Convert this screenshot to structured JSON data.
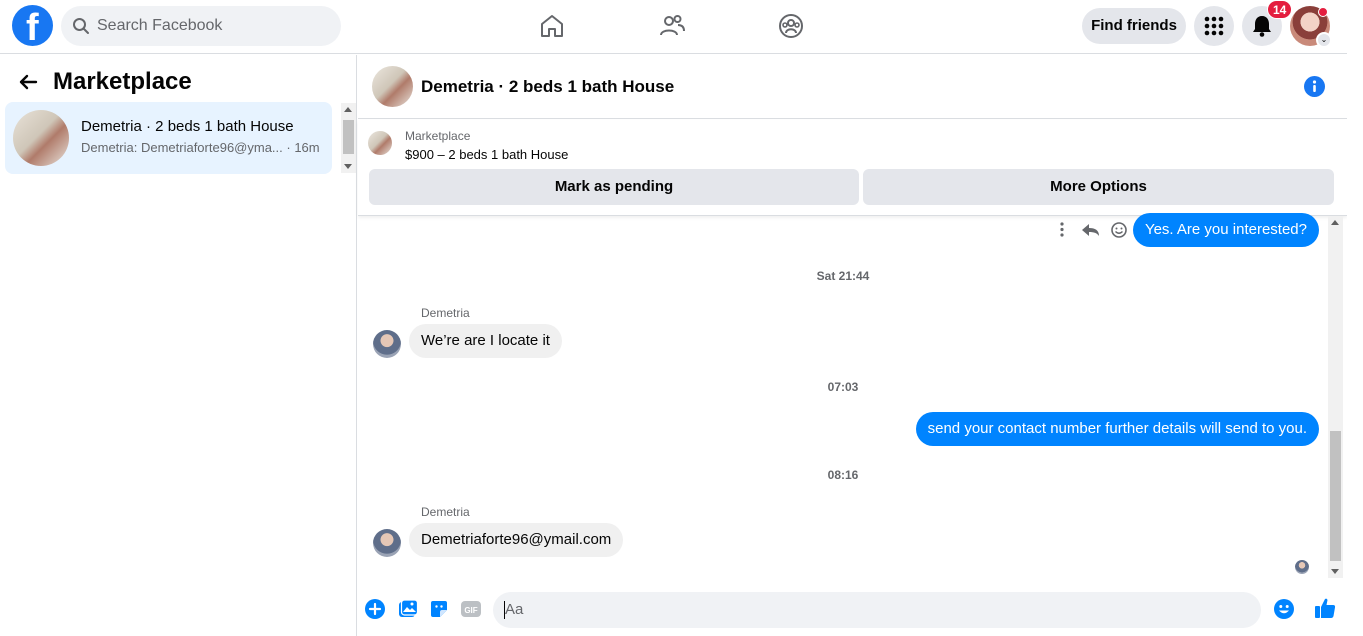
{
  "topbar": {
    "logo_letter": "f",
    "search_placeholder": "Search Facebook",
    "nav_icons": [
      "home-icon",
      "friends-icon",
      "groups-icon"
    ],
    "find_friends_label": "Find friends",
    "notification_count": "14"
  },
  "left": {
    "title": "Marketplace",
    "conversations": [
      {
        "name": "Demetria · 2 beds 1 bath House",
        "preview": "Demetria: Demetriaforte96@yma... · 16m"
      }
    ]
  },
  "chat": {
    "title": "Demetria · 2 beds 1 bath House",
    "listing_kind": "Marketplace",
    "listing_price": "$900 – 2 beds 1 bath House",
    "mark_pending_label": "Mark as pending",
    "more_options_label": "More Options",
    "messages": {
      "out1": "Yes. Are you interested?",
      "ts1": "Sat 21:44",
      "sender1": "Demetria",
      "in1": "We’re are I locate it",
      "ts2": "07:03",
      "out2": "send your contact number further details will send to you.",
      "ts3": "08:16",
      "sender2": "Demetria",
      "in2": "Demetriaforte96@ymail.com"
    },
    "composer_placeholder": "Aa",
    "composer_tools": [
      "plus-icon",
      "photo-icon",
      "sticker-icon",
      "gif-icon"
    ],
    "accent_color": "#0084ff",
    "brand_color": "#1877f2"
  }
}
